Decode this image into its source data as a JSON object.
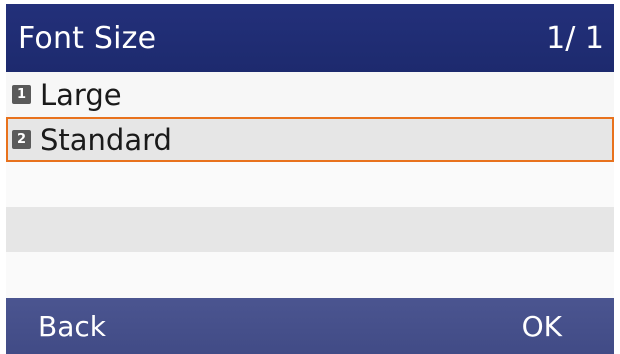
{
  "header": {
    "title": "Font Size",
    "page_indicator": "1/ 1"
  },
  "menu": {
    "items": [
      {
        "number": "1",
        "label": "Large",
        "selected": false
      },
      {
        "number": "2",
        "label": "Standard",
        "selected": true
      }
    ]
  },
  "softkeys": {
    "left_label": "Back",
    "right_label": "OK"
  },
  "colors": {
    "title_bar": "#1f2c70",
    "softkey_bar": "#454f8a",
    "selection_border": "#e8721d"
  }
}
